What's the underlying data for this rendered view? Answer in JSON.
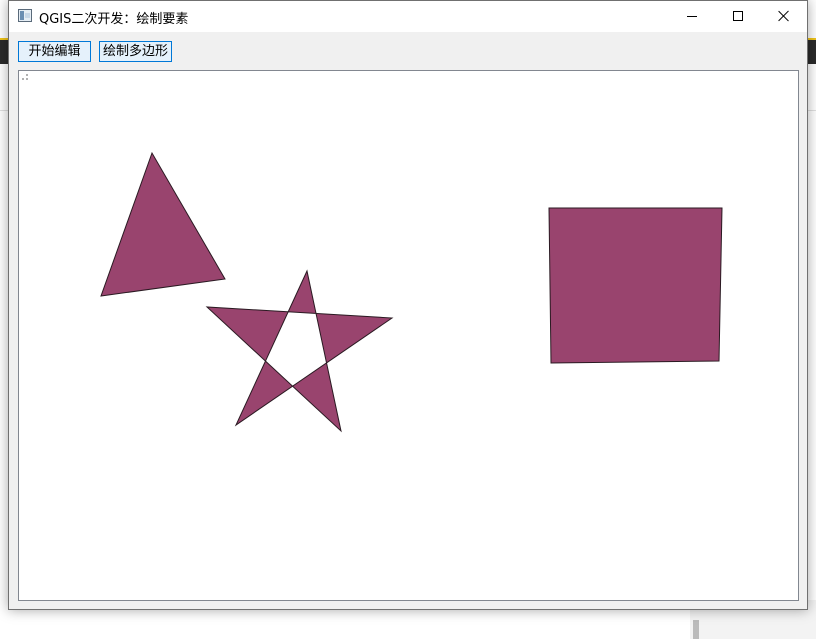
{
  "window": {
    "title": "QGIS二次开发：绘制要素"
  },
  "toolbar": {
    "start_edit_label": "开始编辑",
    "draw_polygon_label": "绘制多边形"
  },
  "canvas": {
    "feature_fill": "#99446e",
    "feature_stroke": "#2a1a22",
    "features": [
      {
        "name": "triangle-feature",
        "type": "polygon"
      },
      {
        "name": "star-feature",
        "type": "polygon"
      },
      {
        "name": "square-feature",
        "type": "polygon"
      }
    ]
  },
  "icons": {
    "app": "qgis-app-icon",
    "minimize": "minimize-icon",
    "maximize": "maximize-icon",
    "close": "close-icon"
  }
}
